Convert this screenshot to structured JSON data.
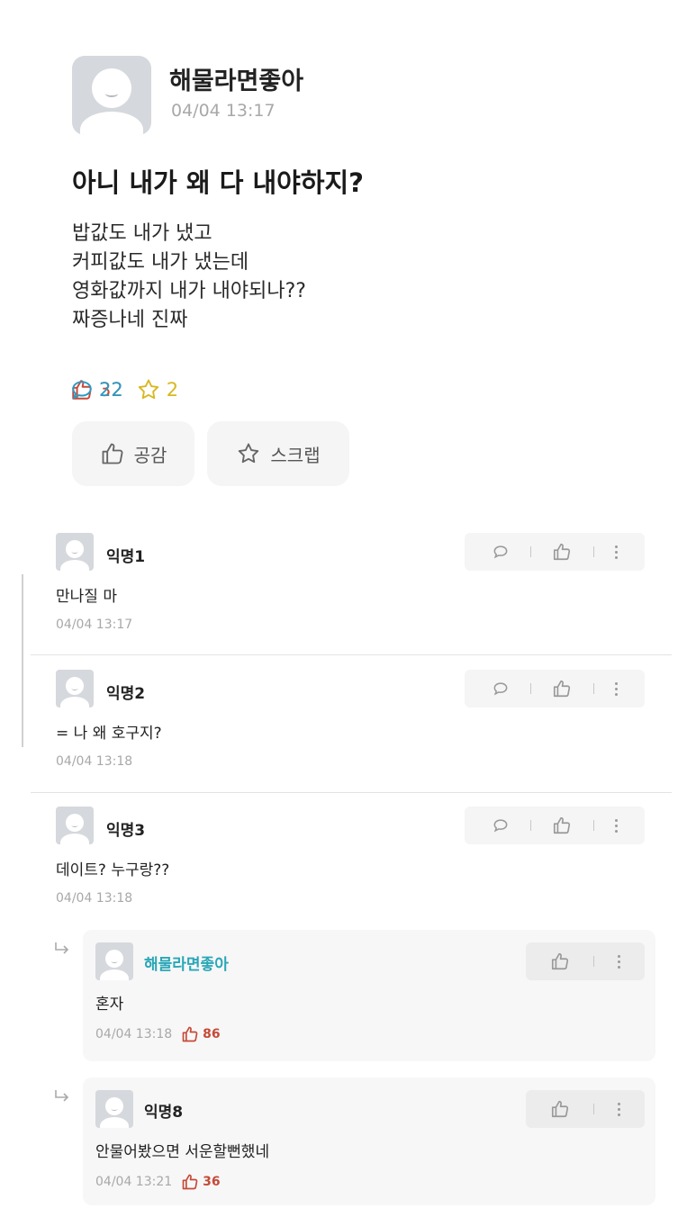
{
  "post": {
    "author": "해물라면좋아",
    "time": "04/04 13:17",
    "title": "아니 내가 왜 다 내야하지?",
    "body_lines": [
      "밥값도 내가 냈고",
      "커피값도 내가 냈는데",
      "영화값까지 내가 내야되나??",
      "짜증나네 진짜"
    ],
    "stats": {
      "likes": "32",
      "comments": "22",
      "scraps": "2"
    },
    "buttons": {
      "like_label": "공감",
      "scrap_label": "스크랩"
    }
  },
  "comments": [
    {
      "name": "익명1",
      "text": "만나질 마",
      "time": "04/04 13:17"
    },
    {
      "name": "익명2",
      "text": "= 나 왜 호구지?",
      "time": "04/04 13:18"
    },
    {
      "name": "익명3",
      "text": "데이트? 누구랑??",
      "time": "04/04 13:18"
    }
  ],
  "replies": [
    {
      "name": "해물라면좋아",
      "text": "혼자",
      "time": "04/04 13:18",
      "likes": "86",
      "name_color": "#2aa7b7"
    },
    {
      "name": "익명8",
      "text": "안물어봤으면 서운할뻔했네",
      "time": "04/04 13:21",
      "likes": "36",
      "name_color": "#222222"
    }
  ],
  "colors": {
    "like": "#c64a38",
    "comment": "#2b9ac4",
    "scrap": "#d8b820",
    "author_highlight": "#2aa7b7"
  },
  "icons": [
    "thumbs-up-icon",
    "speech-bubble-icon",
    "star-icon",
    "more-vertical-icon",
    "reply-arrow-icon"
  ]
}
